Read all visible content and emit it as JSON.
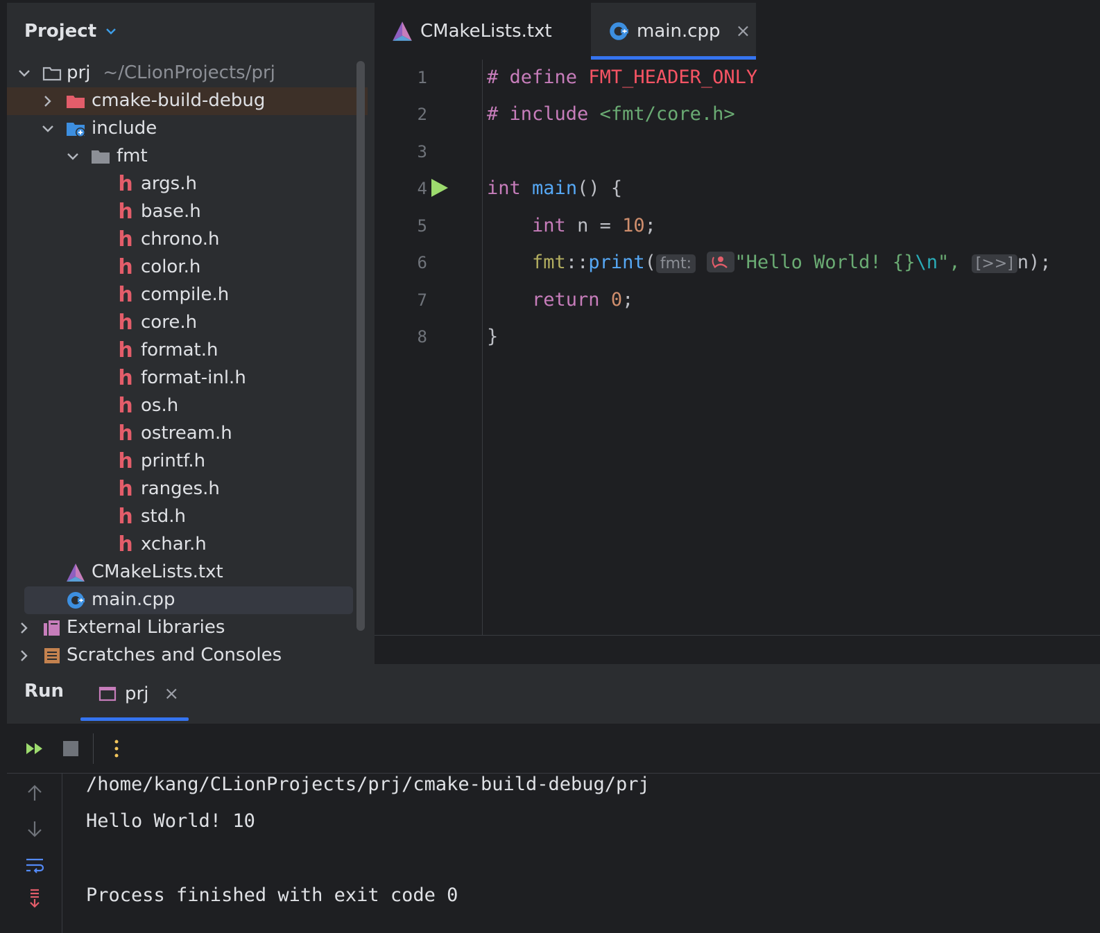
{
  "project_panel": {
    "title": "Project",
    "tree": [
      {
        "label": "prj",
        "sub": "~/CLionProjects/prj",
        "icon": "folder-outline-icon",
        "expanded": true
      },
      {
        "label": "cmake-build-debug",
        "icon": "folder-excluded-icon",
        "expanded": false
      },
      {
        "label": "include",
        "icon": "folder-include-icon",
        "expanded": true
      },
      {
        "label": "fmt",
        "icon": "folder-icon",
        "expanded": true
      },
      {
        "label": "args.h",
        "icon": "header-file-icon"
      },
      {
        "label": "base.h",
        "icon": "header-file-icon"
      },
      {
        "label": "chrono.h",
        "icon": "header-file-icon"
      },
      {
        "label": "color.h",
        "icon": "header-file-icon"
      },
      {
        "label": "compile.h",
        "icon": "header-file-icon"
      },
      {
        "label": "core.h",
        "icon": "header-file-icon"
      },
      {
        "label": "format.h",
        "icon": "header-file-icon"
      },
      {
        "label": "format-inl.h",
        "icon": "header-file-icon"
      },
      {
        "label": "os.h",
        "icon": "header-file-icon"
      },
      {
        "label": "ostream.h",
        "icon": "header-file-icon"
      },
      {
        "label": "printf.h",
        "icon": "header-file-icon"
      },
      {
        "label": "ranges.h",
        "icon": "header-file-icon"
      },
      {
        "label": "std.h",
        "icon": "header-file-icon"
      },
      {
        "label": "xchar.h",
        "icon": "header-file-icon"
      },
      {
        "label": "CMakeLists.txt",
        "icon": "cmake-icon"
      },
      {
        "label": "main.cpp",
        "icon": "cpp-file-icon"
      },
      {
        "label": "External Libraries",
        "icon": "libraries-icon",
        "expanded": false
      },
      {
        "label": "Scratches and Consoles",
        "icon": "scratches-icon",
        "expanded": false
      }
    ]
  },
  "editor": {
    "tabs": [
      {
        "label": "CMakeLists.txt",
        "active": false
      },
      {
        "label": "main.cpp",
        "active": true,
        "close": "×"
      }
    ],
    "line_numbers": [
      "1",
      "2",
      "3",
      "4",
      "5",
      "6",
      "7",
      "8"
    ],
    "code": {
      "l1_hash": "# define",
      "l1_macro": "FMT_HEADER_ONLY",
      "l2_hash": "# include",
      "l2_path": "<fmt/core.h>",
      "l4_int": "int",
      "l4_main": "main",
      "l4_rest": "() {",
      "l5_int": "int",
      "l5_mid": " n = ",
      "l5_num": "10",
      "l5_end": ";",
      "l6_ns": "fmt",
      "l6_sep": "::",
      "l6_fn": "print",
      "l6_open": "(",
      "l6_hint1": "fmt:",
      "l6_str_a": "\"Hello World! {}",
      "l6_str_esc": "\\n",
      "l6_str_b": "\",",
      "l6_hint2": "[>>]",
      "l6_end": "n);",
      "l7_return": "return",
      "l7_num": "0",
      "l7_end": ";",
      "l8": "}"
    }
  },
  "run_panel": {
    "title": "Run",
    "tab_label": "prj",
    "tab_close": "×",
    "output": [
      "/home/kang/CLionProjects/prj/cmake-build-debug/prj",
      "Hello World! 10",
      "",
      "Process finished with exit code 0"
    ]
  },
  "colors": {
    "background": "#1e1f22",
    "panel": "#2b2d30",
    "accent": "#3574f0",
    "header_icon": "#e35d6a",
    "run_green": "#9ddb6e"
  }
}
